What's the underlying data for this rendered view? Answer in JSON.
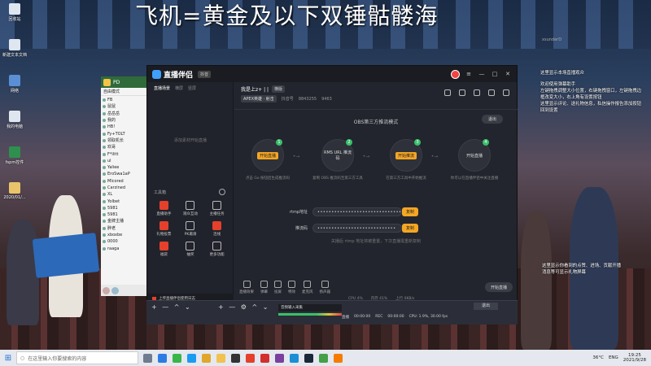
{
  "headline": "飞机=黄金及以下双锤骷髅海",
  "desktop": {
    "icons": [
      "回收站",
      "新建文本文档",
      "网络",
      "我的电脑",
      "fspm控件",
      "2020/01/..."
    ]
  },
  "chat_window": {
    "header": "PD",
    "tab": "自由模式",
    "rows": [
      "FB",
      "鼠鼠",
      "岳岳岳",
      "我的",
      "HB!",
      "Fy+TOLT",
      "领取机长",
      "欢哥",
      "F*ilitt",
      "ul",
      "Yaliee",
      "EroSwa1aP",
      "Mlcored",
      "Carzined",
      "XL",
      "Yolbet",
      "5981",
      "5981",
      "金牌主播",
      "胖老",
      "xboxbe",
      "0000",
      "raaga"
    ]
  },
  "app": {
    "name": "直播伴侣",
    "version_badge": "抖音",
    "left_tabs": [
      "直播场景",
      "横屏",
      "竖屏"
    ],
    "empty_scene": "添加素材开始直播",
    "tools_title": "工具箱",
    "tools": [
      {
        "label": "直播助手",
        "highlight": true
      },
      {
        "label": "观众互动",
        "highlight": false
      },
      {
        "label": "主播任务",
        "highlight": false
      },
      {
        "label": "礼物投票",
        "highlight": false
      },
      {
        "label": "PK邀请",
        "highlight": false
      },
      {
        "label": "连线",
        "highlight": true
      },
      {
        "label": "福袋",
        "highlight": false
      },
      {
        "label": "抽奖",
        "highlight": false
      },
      {
        "label": "更多功能",
        "highlight": false
      }
    ],
    "left_footer": "上传直播伴侣使用日志",
    "room": {
      "title": "我是上z+ | |",
      "title_tag": "横版",
      "category_pill": "APEX英雄 · 射击",
      "id_label": "抖音号",
      "id_value": "8843255",
      "fans": "9463"
    },
    "mode_title": "OBS第三方推流模式",
    "exit_label": "退出",
    "steps": [
      {
        "num": "1",
        "label": "开始直播",
        "caption": "点击 Go 按钮后生成推流码",
        "orange": false
      },
      {
        "num": "2",
        "label": "RMS URL\n推流码",
        "caption": "复制 OBS 推流码至第三方工具",
        "orange": false
      },
      {
        "num": "3",
        "label": "开始推流",
        "caption": "在第三方工具中开始推流",
        "orange": true
      },
      {
        "num": "4",
        "label": "开始直播",
        "caption": "你可以在直播伴侣中关注直播",
        "orange": false
      }
    ],
    "rtmp_label": "rtmp地址",
    "rtmp_value": "••••••••••••••••••••••••••••••••••",
    "stream_key_label": "推流码",
    "stream_key_value": "••••••••••••••••••••••••••••",
    "copy_label": "复制",
    "hint": "关播后 rtmp 地址将被重置，下次直播需重新复制",
    "bottom_items": [
      "直播效果",
      "弹幕",
      "投屏",
      "特效",
      "麦克风",
      "扬声器"
    ],
    "start_label": "开始直播",
    "status": [
      "CPU 4%",
      "内存 41%",
      "上行 0KB/s"
    ]
  },
  "obs": {
    "controls_left": "+ — ^ ⌄",
    "controls_mid": "+ — ⚙ ^ ⌄",
    "track": "音频输入采集",
    "live": "直播",
    "live_time": "00:00:00",
    "rec": "REC",
    "rec_time": "00:00:00",
    "cpu": "CPU: 1.9%, 30.00 fps",
    "exit": "退出"
  },
  "right_chat": {
    "name": "xsunderD",
    "messages": [
      "这里显示本场直播观众",
      "欢迎使用弹幕助手\n左键拖拽调整大小位置，右键拖拽窗口，左键拖拽边框改变大小，右上角有设置按钮\n这里显示评论、送礼物信息，私信操作报告添加按钮回到设置"
    ],
    "messages_2": "这里显示你看到的点赞、进场、贡献开播\n消息等可显示礼物屏幕"
  },
  "taskbar": {
    "search_placeholder": "在这里输入你要搜索的内容",
    "weather": "36°C",
    "lang": "ENG",
    "time": "19:25",
    "date": "2021/9/28"
  },
  "colors": {
    "accent": "#f5a623",
    "brand": "#3fa0ff",
    "live_red": "#e5402b"
  }
}
